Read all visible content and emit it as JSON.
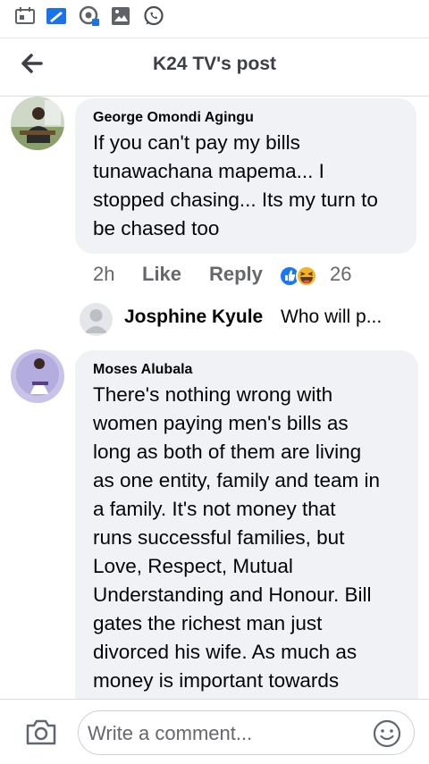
{
  "status_bar": {
    "icons": [
      "calendar-icon",
      "image-edit-icon",
      "camera-sync-icon",
      "gallery-icon",
      "whatsapp-icon"
    ]
  },
  "header": {
    "back_icon": "arrow-left-icon",
    "title": "K24 TV's post"
  },
  "comments": [
    {
      "author": "George Omondi Agingu",
      "lines": [
        "If you can't pay my bills",
        "tunawachana mapema... I",
        "stopped chasing... Its my turn to",
        "be chased too"
      ],
      "time": "2h",
      "like_label": "Like",
      "reply_label": "Reply",
      "reaction_count": "26",
      "reactions": [
        "like-reaction-icon",
        "haha-reaction-icon"
      ]
    },
    {
      "author": "Moses Alubala",
      "lines": [
        "There's nothing wrong with",
        "women paying men's bills as",
        "long as both of them are living",
        "as one entity, family and team in",
        "a family. It's not money that",
        "runs successful families, but",
        "Love, Respect, Mutual",
        "Understanding and Honour. Bill",
        "gates the richest man just",
        "divorced his wife. As much as",
        "money is important towards"
      ]
    }
  ],
  "reply_preview": {
    "author": "Josphine Kyule",
    "text": "Who will p..."
  },
  "composer": {
    "placeholder": "Write a comment...",
    "camera_icon": "camera-icon",
    "emoji_icon": "smiley-icon"
  },
  "colors": {
    "bubble": "#f0f2f5",
    "like_blue": "#1877f2",
    "haha_yellow": "#f7b125",
    "secondary_text": "#65676b"
  }
}
